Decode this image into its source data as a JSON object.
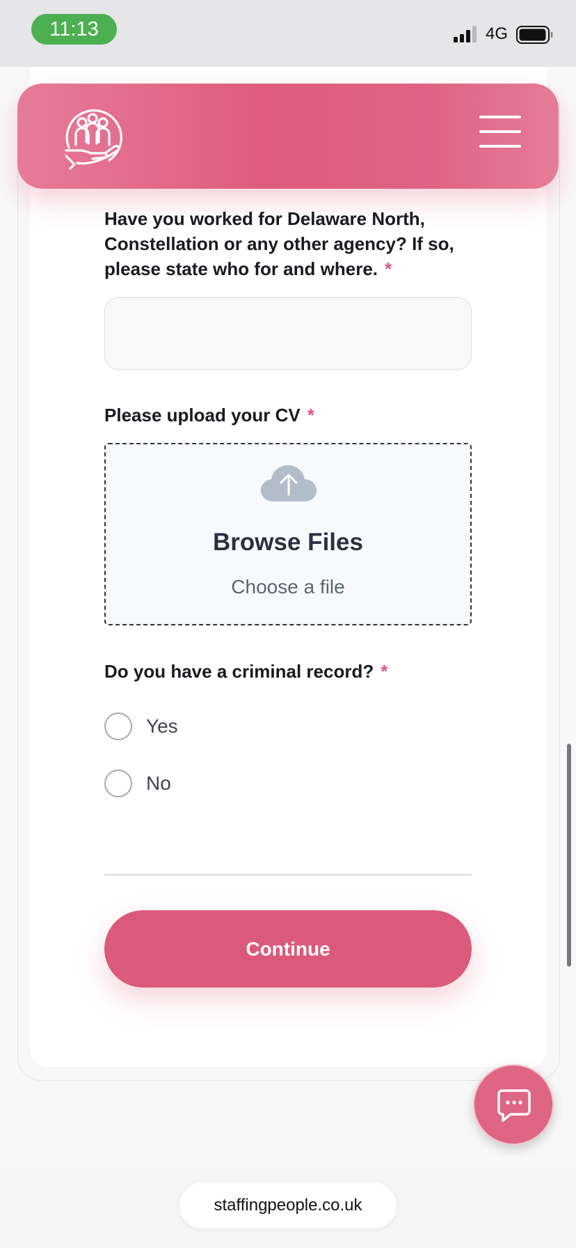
{
  "status_bar": {
    "time": "11:13",
    "network": "4G",
    "icons": [
      "signal-icon",
      "battery-icon"
    ]
  },
  "header": {
    "logo_icon": "people-in-hand-logo",
    "menu_icon": "hamburger-menu-icon",
    "accent_color": "#df5c7e"
  },
  "form": {
    "agency_question": "Have you worked for Delaware North, Constellation or any other agency? If so, please state who for and where.",
    "agency_input_value": "",
    "required_marker": "*",
    "cv_label": "Please upload your CV",
    "upload": {
      "icon": "cloud-upload-icon",
      "title": "Browse Files",
      "subtitle": "Choose a file"
    },
    "criminal_question": "Do you have a criminal record?",
    "options": [
      {
        "label": "Yes",
        "selected": false
      },
      {
        "label": "No",
        "selected": false
      }
    ],
    "continue_label": "Continue",
    "button_color": "#db5a7b"
  },
  "chat": {
    "icon": "chat-bubble-icon"
  },
  "browser": {
    "url": "staffingpeople.co.uk"
  }
}
